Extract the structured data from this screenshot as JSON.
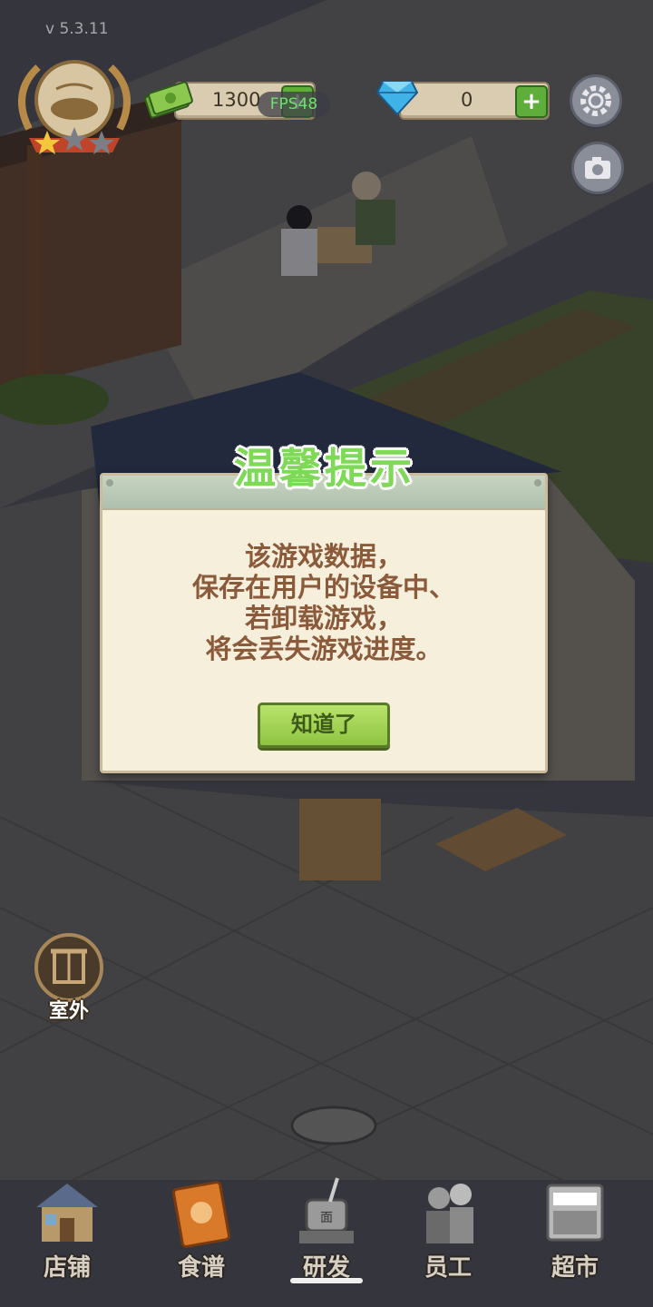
{
  "app": {
    "version": "v 5.3.11"
  },
  "hud": {
    "cash": {
      "value": "1300",
      "icon": "money-stack-icon"
    },
    "gems": {
      "value": "0",
      "icon": "diamond-icon"
    },
    "plus_label": "+",
    "fps": "FPS48"
  },
  "side": {
    "outdoor_label": "室外"
  },
  "dialog": {
    "title": "温馨提示",
    "lines": [
      "该游戏数据，",
      "保存在用户的设备中、",
      "若卸载游戏，",
      "将会丢失游戏进度。"
    ],
    "confirm_label": "知道了"
  },
  "nav": [
    {
      "label": "店铺",
      "icon": "shop-icon"
    },
    {
      "label": "食谱",
      "icon": "recipe-book-icon"
    },
    {
      "label": "研发",
      "icon": "cooking-pot-icon"
    },
    {
      "label": "员工",
      "icon": "staff-icon"
    },
    {
      "label": "超市",
      "icon": "supermarket-icon"
    }
  ],
  "colors": {
    "accent_green": "#7ed957",
    "dialog_text": "#8b5a3a",
    "dialog_bg": "#f6efdc"
  }
}
